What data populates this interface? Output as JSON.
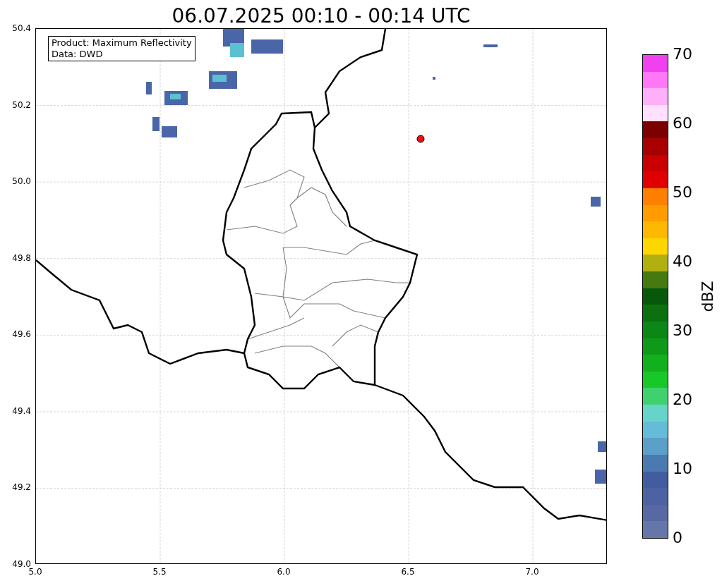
{
  "title": "06.07.2025 00:10 - 00:14 UTC",
  "map": {
    "legend": [
      "Product: Maximum Reflectivity",
      "Data: DWD"
    ],
    "xticks": [
      "5.0",
      "5.5",
      "6.0",
      "6.5",
      "7.0"
    ],
    "yticks": [
      "50.4",
      "50.2",
      "50.0",
      "49.8",
      "49.6",
      "49.4",
      "49.2",
      "49.0"
    ]
  },
  "colorbar": {
    "label": "dBZ",
    "ticks": [
      "70",
      "60",
      "50",
      "40",
      "30",
      "20",
      "10",
      "0"
    ],
    "bands": [
      {
        "color": "#6477a8"
      },
      {
        "color": "#5868a2"
      },
      {
        "color": "#4d62a2"
      },
      {
        "color": "#425ca0"
      },
      {
        "color": "#4a7ab0"
      },
      {
        "color": "#5ba0c8"
      },
      {
        "color": "#64bcd8"
      },
      {
        "color": "#66d4c8"
      },
      {
        "color": "#40d070"
      },
      {
        "color": "#18c828"
      },
      {
        "color": "#12b01c"
      },
      {
        "color": "#0e9a18"
      },
      {
        "color": "#0c8614"
      },
      {
        "color": "#0a7010"
      },
      {
        "color": "#08580c"
      },
      {
        "color": "#467a10"
      },
      {
        "color": "#b0b010"
      },
      {
        "color": "#ffd700"
      },
      {
        "color": "#ffb800"
      },
      {
        "color": "#ff9c00"
      },
      {
        "color": "#ff8000"
      },
      {
        "color": "#e00000"
      },
      {
        "color": "#c80000"
      },
      {
        "color": "#a80000"
      },
      {
        "color": "#7c0000"
      },
      {
        "color": "#ffe0ff"
      },
      {
        "color": "#ffb0f8"
      },
      {
        "color": "#ff78f8"
      },
      {
        "color": "#f040f0"
      }
    ]
  }
}
